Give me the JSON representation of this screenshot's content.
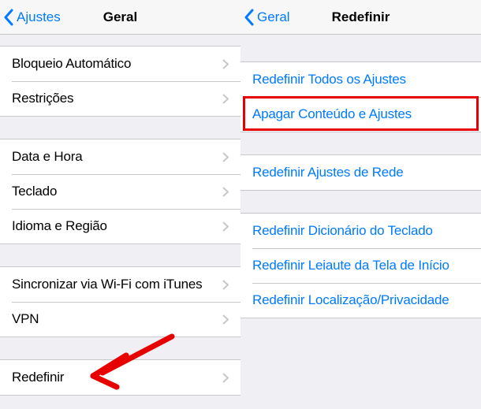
{
  "left": {
    "back": "Ajustes",
    "title": "Geral",
    "group1": [
      {
        "label": "Bloqueio Automático"
      },
      {
        "label": "Restrições"
      }
    ],
    "group2": [
      {
        "label": "Data e Hora"
      },
      {
        "label": "Teclado"
      },
      {
        "label": "Idioma e Região"
      }
    ],
    "group3": [
      {
        "label": "Sincronizar via Wi-Fi com iTunes"
      },
      {
        "label": "VPN"
      }
    ],
    "group4": [
      {
        "label": "Redefinir"
      }
    ]
  },
  "right": {
    "back": "Geral",
    "title": "Redefinir",
    "group1": [
      {
        "label": "Redefinir Todos os Ajustes"
      },
      {
        "label": "Apagar Conteúdo e Ajustes"
      }
    ],
    "group2": [
      {
        "label": "Redefinir Ajustes de Rede"
      }
    ],
    "group3": [
      {
        "label": "Redefinir Dicionário do Teclado"
      },
      {
        "label": "Redefinir Leiaute da Tela de Início"
      },
      {
        "label": "Redefinir Localização/Privacidade"
      }
    ]
  },
  "annotations": {
    "highlight_target": "Apagar Conteúdo e Ajustes",
    "arrow_target": "Redefinir",
    "accent_color": "#e60000"
  }
}
